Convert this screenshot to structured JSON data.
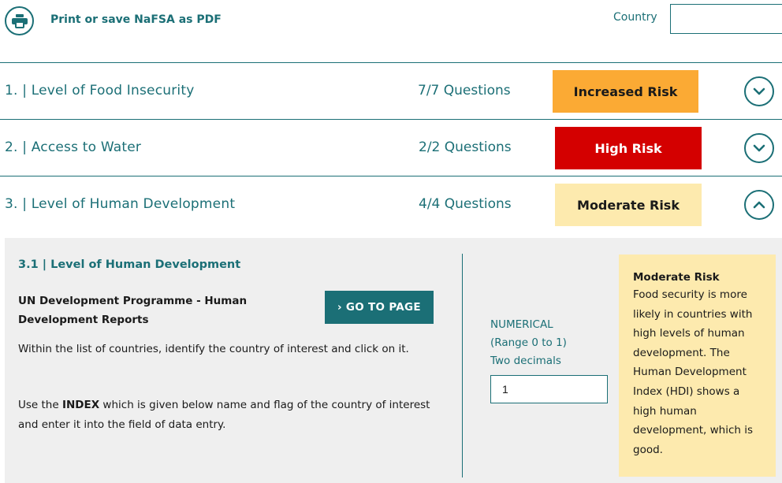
{
  "toolbar": {
    "print_label": "Print or save NaFSA as PDF",
    "print_icon": "printer-icon",
    "country_label": "Country",
    "country_value": ""
  },
  "rows": [
    {
      "title": "1.  |  Level of Food Insecurity",
      "count": "7/7 Questions",
      "risk": "Increased Risk",
      "risk_color": "#fbaa34",
      "risk_text_color": "#1a1a1a",
      "expanded": false,
      "chevron_icon": "chevron-down-icon"
    },
    {
      "title": "2.  |  Access to Water",
      "count": "2/2 Questions",
      "risk": "High Risk",
      "risk_color": "#d40000",
      "risk_text_color": "#ffffff",
      "expanded": false,
      "chevron_icon": "chevron-down-icon"
    },
    {
      "title": "3.  |  Level of Human Development",
      "count": "4/4 Questions",
      "risk": "Moderate Risk",
      "risk_color": "#fdeaae",
      "risk_text_color": "#1a1a1a",
      "expanded": true,
      "chevron_icon": "chevron-up-icon"
    }
  ],
  "panel": {
    "heading": "3.1  |  Level of Human Development",
    "source": "UN Development Programme - Human Development Reports",
    "goto_label": "› GO TO PAGE",
    "instruction_1": "Within the list of countries, identify the country of interest and click on it.",
    "instruction_2_prefix": "Use the ",
    "instruction_2_bold": "INDEX",
    "instruction_2_suffix": " which is given below name and flag of the country of interest and enter it into the field of data entry.",
    "numerical_1": "NUMERICAL",
    "numerical_2": "(Range 0 to 1)",
    "numerical_3": "Two decimals",
    "input_value": "1",
    "info_title": "Moderate Risk",
    "info_text": "Food security is more likely in countries with high levels of human development. The Human Development Index (HDI) shows a high human development, which is good."
  },
  "colors": {
    "accent": "#1b6f76",
    "panel_bg": "#efefef",
    "info_bg": "#fdeaae"
  }
}
